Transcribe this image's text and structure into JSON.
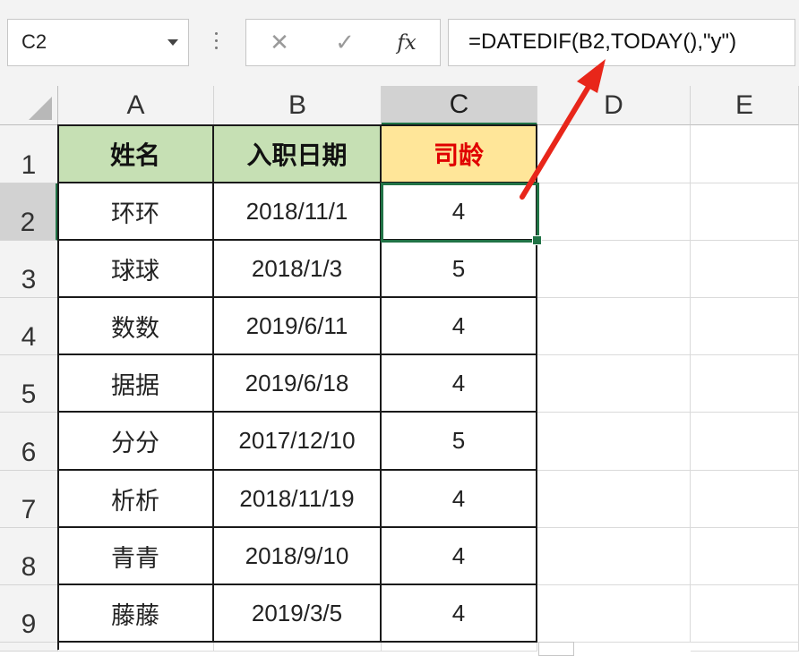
{
  "formula_bar": {
    "name_box": "C2",
    "cancel_icon": "✕",
    "enter_icon": "✓",
    "fx_label": "fx",
    "formula": "=DATEDIF(B2,TODAY(),\"y\")"
  },
  "columns": [
    "A",
    "B",
    "C",
    "D",
    "E"
  ],
  "selected_column": "C",
  "rows": [
    "1",
    "2",
    "3",
    "4",
    "5",
    "6",
    "7",
    "8",
    "9"
  ],
  "selected_row": "2",
  "table": {
    "headers": [
      "姓名",
      "入职日期",
      "司龄"
    ],
    "rows": [
      [
        "环环",
        "2018/11/1",
        "4"
      ],
      [
        "球球",
        "2018/1/3",
        "5"
      ],
      [
        "数数",
        "2019/6/11",
        "4"
      ],
      [
        "据据",
        "2019/6/18",
        "4"
      ],
      [
        "分分",
        "2017/12/10",
        "5"
      ],
      [
        "析析",
        "2018/11/19",
        "4"
      ],
      [
        "青青",
        "2018/9/10",
        "4"
      ],
      [
        "藤藤",
        "2019/3/5",
        "4"
      ]
    ]
  },
  "colors": {
    "header_green": "#c6e0b4",
    "header_yellow": "#ffe699",
    "header_red_text": "#e00000",
    "selection_green": "#217346",
    "arrow_red": "#e8261a"
  }
}
